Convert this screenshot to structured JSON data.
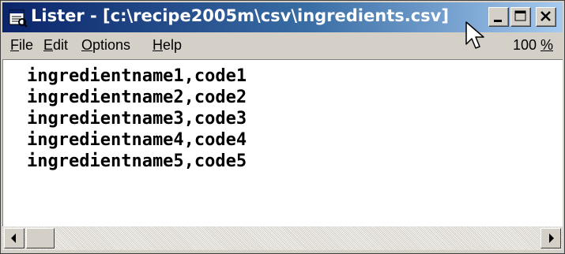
{
  "window": {
    "title": "Lister - [c:\\recipe2005m\\csv\\ingredients.csv]",
    "app_icon": "lister-app-icon"
  },
  "menu": {
    "items": [
      {
        "hot": "F",
        "rest": "ile"
      },
      {
        "hot": "E",
        "rest": "dit"
      },
      {
        "hot": "O",
        "rest": "ptions"
      },
      {
        "hot": "H",
        "rest": "elp"
      }
    ],
    "zoom_num": "100 ",
    "zoom_pct": "%"
  },
  "file": {
    "lines": [
      "ingredientname1,code1",
      "ingredientname2,code2",
      "ingredientname3,code3",
      "ingredientname4,code4",
      "ingredientname5,code5"
    ]
  },
  "icons": {
    "minimize": "minimize-icon",
    "maximize": "maximize-icon",
    "close": "close-icon",
    "scroll_left": "arrow-left-icon",
    "scroll_right": "arrow-right-icon",
    "pointer": "mouse-pointer-icon"
  }
}
